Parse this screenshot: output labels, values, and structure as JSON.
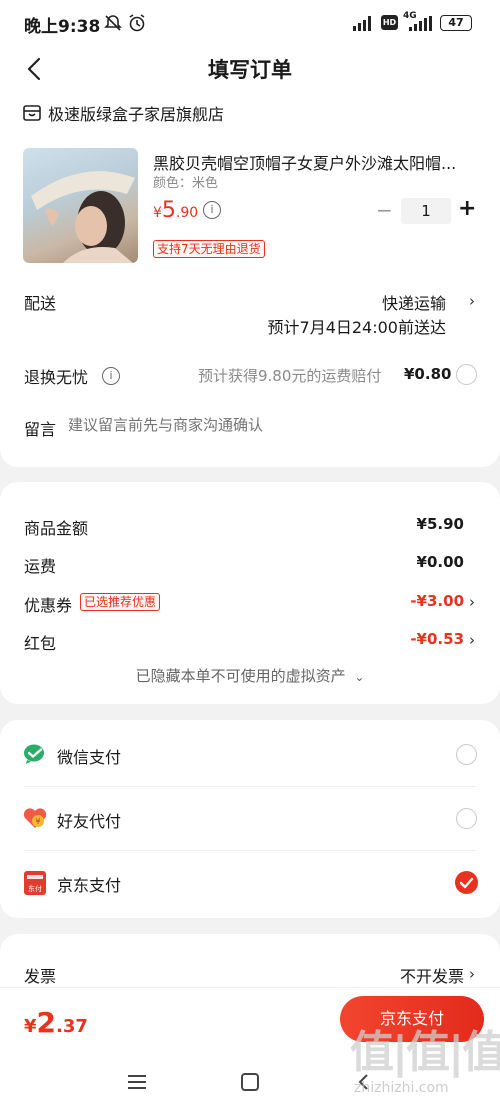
{
  "status_bar": {
    "time": "晚上9:38",
    "battery": "47",
    "net": "4G"
  },
  "nav": {
    "title": "填写订单"
  },
  "shop": {
    "name": "极速版绿盒子家居旗舰店"
  },
  "product": {
    "title": "黑胶贝壳帽空顶帽子女夏户外沙滩太阳帽...",
    "spec": "颜色：米色",
    "price_symbol": "¥",
    "price_int": "5",
    "price_dec": ".90",
    "quantity": "1",
    "minus": "−",
    "plus": "+",
    "return_tag": "支持7天无理由退货"
  },
  "delivery": {
    "label": "配送",
    "method": "快递运输",
    "eta": "预计7月4日24:00前送达"
  },
  "returns": {
    "label": "退换无忧",
    "desc": "预计获得9.80元的运费赔付",
    "price": "¥0.80"
  },
  "message": {
    "label": "留言",
    "placeholder": "建议留言前先与商家沟通确认"
  },
  "summary": {
    "goods_label": "商品金额",
    "goods_value": "¥5.90",
    "shipping_label": "运费",
    "shipping_value": "¥0.00",
    "coupon_label": "优惠券",
    "coupon_tag": "已选推荐优惠",
    "coupon_value": "-¥3.00",
    "redpacket_label": "红包",
    "redpacket_value": "-¥0.53",
    "hidden_note": "已隐藏本单不可使用的虚拟资产"
  },
  "payment": {
    "wechat": "微信支付",
    "friend": "好友代付",
    "jd": "京东支付",
    "selected": "jd"
  },
  "invoice": {
    "label": "发票",
    "value": "不开发票"
  },
  "bottom": {
    "total_symbol": "¥",
    "total_int": "2",
    "total_dec": ".37",
    "pay_button": "京东支付"
  },
  "watermark": {
    "cn": "值|值|值",
    "url": "zhizhizhi.com"
  },
  "colors": {
    "accent": "#e8321e",
    "wechat": "#2aae67"
  }
}
